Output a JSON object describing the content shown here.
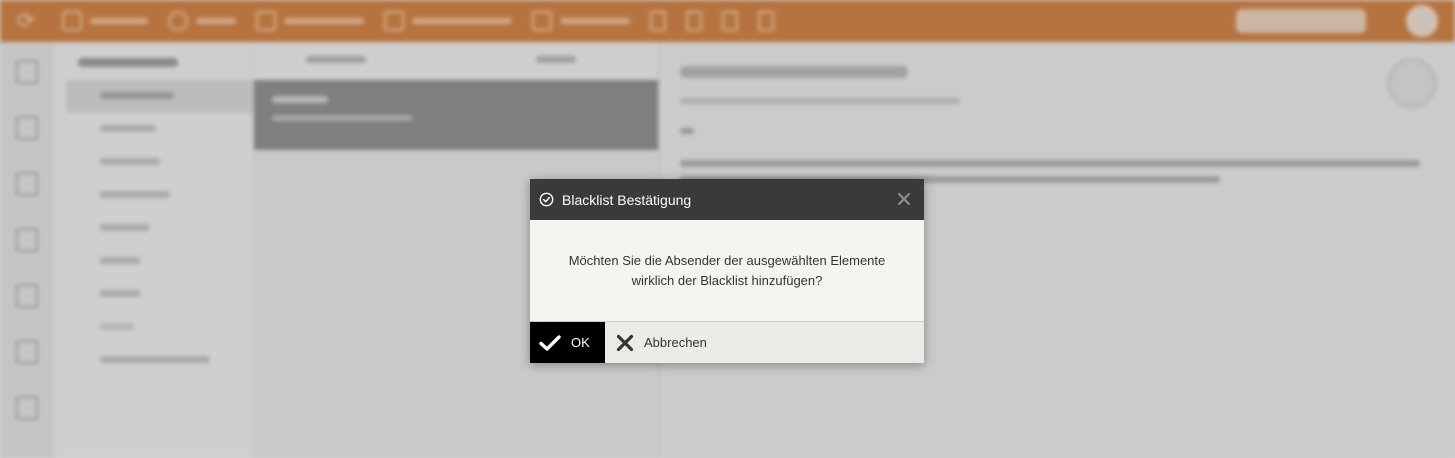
{
  "dialog": {
    "title": "Blacklist Bestätigung",
    "message": "Möchten Sie die Absender der ausgewählten Elemente wirklich der Blacklist hinzufügen?",
    "ok_label": "OK",
    "cancel_label": "Abbrechen",
    "icons": {
      "title": "check-circle-icon",
      "close": "close-icon",
      "ok": "checkmark-icon",
      "cancel": "cross-icon"
    }
  },
  "colors": {
    "brand_orange": "#c76a22",
    "dialog_header": "#3a3a3a",
    "ok_button": "#000000"
  }
}
